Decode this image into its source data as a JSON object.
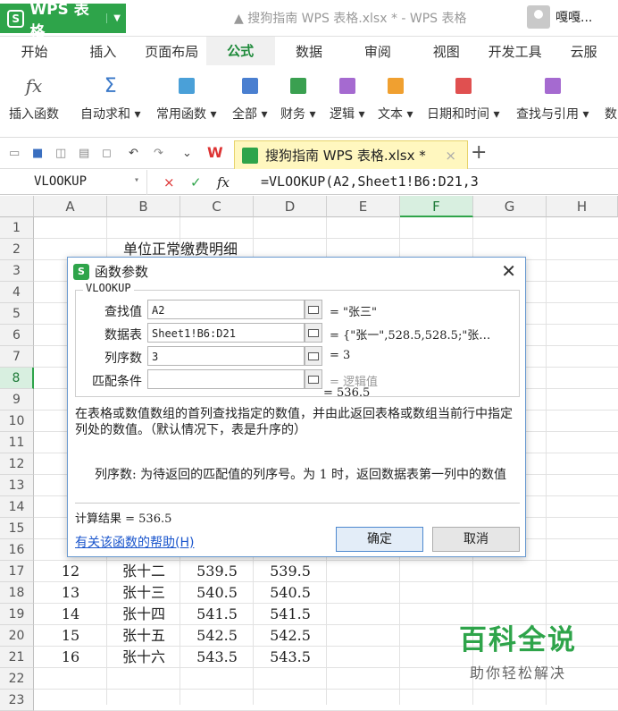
{
  "app": {
    "name": "WPS 表格",
    "badge": "S",
    "window_title": "搜狗指南 WPS 表格.xlsx * - WPS 表格",
    "user": "嘎嘎..."
  },
  "menu": [
    "开始",
    "插入",
    "页面布局",
    "公式",
    "数据",
    "审阅",
    "视图",
    "开发工具",
    "云服"
  ],
  "menu_active": "公式",
  "ribbon": {
    "insert_fn": "插入函数",
    "autosum": "自动求和",
    "common": "常用函数",
    "all": "全部",
    "finance": "财务",
    "logic": "逻辑",
    "text": "文本",
    "datetime": "日期和时间",
    "lookup": "查找与引用",
    "math": "数"
  },
  "doc_tab": {
    "label": "搜狗指南  WPS 表格.xlsx *",
    "close": "×"
  },
  "formula_bar": {
    "name_box": "VLOOKUP",
    "cancel": "×",
    "confirm": "✓",
    "fx": "fx",
    "formula": "=VLOOKUP(A2,Sheet1!B6:D21,3"
  },
  "columns": [
    "A",
    "B",
    "C",
    "D",
    "E",
    "F",
    "G",
    "H"
  ],
  "selected_column": "F",
  "rows": [
    "1",
    "2",
    "3",
    "4",
    "5",
    "6",
    "7",
    "8",
    "9",
    "10",
    "11",
    "12",
    "13",
    "14",
    "15",
    "16",
    "17",
    "18",
    "19",
    "20",
    "21",
    "22",
    "23"
  ],
  "selected_row": "8",
  "sheet_title": "单位正常缴费明细",
  "table_rows": [
    {
      "a": "12",
      "b": "张十二",
      "c": "539.5",
      "d": "539.5"
    },
    {
      "a": "13",
      "b": "张十三",
      "c": "540.5",
      "d": "540.5"
    },
    {
      "a": "14",
      "b": "张十四",
      "c": "541.5",
      "d": "541.5"
    },
    {
      "a": "15",
      "b": "张十五",
      "c": "542.5",
      "d": "542.5"
    },
    {
      "a": "16",
      "b": "张十六",
      "c": "543.5",
      "d": "543.5"
    }
  ],
  "watermark": {
    "title": "百科全说",
    "subtitle": "助你轻松解决"
  },
  "dialog": {
    "title": "函数参数",
    "function": "VLOOKUP",
    "args": [
      {
        "label": "查找值",
        "value": "A2",
        "result": "= \"张三\""
      },
      {
        "label": "数据表",
        "value": "Sheet1!B6:D21",
        "result": "= {\"张一\",528.5,528.5;\"张…"
      },
      {
        "label": "列序数",
        "value": "3",
        "result": "= 3"
      },
      {
        "label": "匹配条件",
        "value": "",
        "result": "= 逻辑值"
      }
    ],
    "result_line": "= 536.5",
    "description": "在表格或数值数组的首列查找指定的数值，并由此返回表格或数组当前行中指定列处的数值。（默认情况下，表是升序的）",
    "param_name": "列序数:",
    "param_desc": "为待返回的匹配值的列序号。为 1 时，返回数据表第一列中的数值",
    "calc_result": "计算结果 = 536.5",
    "help_link": "有关该函数的帮助(H)",
    "ok": "确定",
    "cancel": "取消"
  }
}
